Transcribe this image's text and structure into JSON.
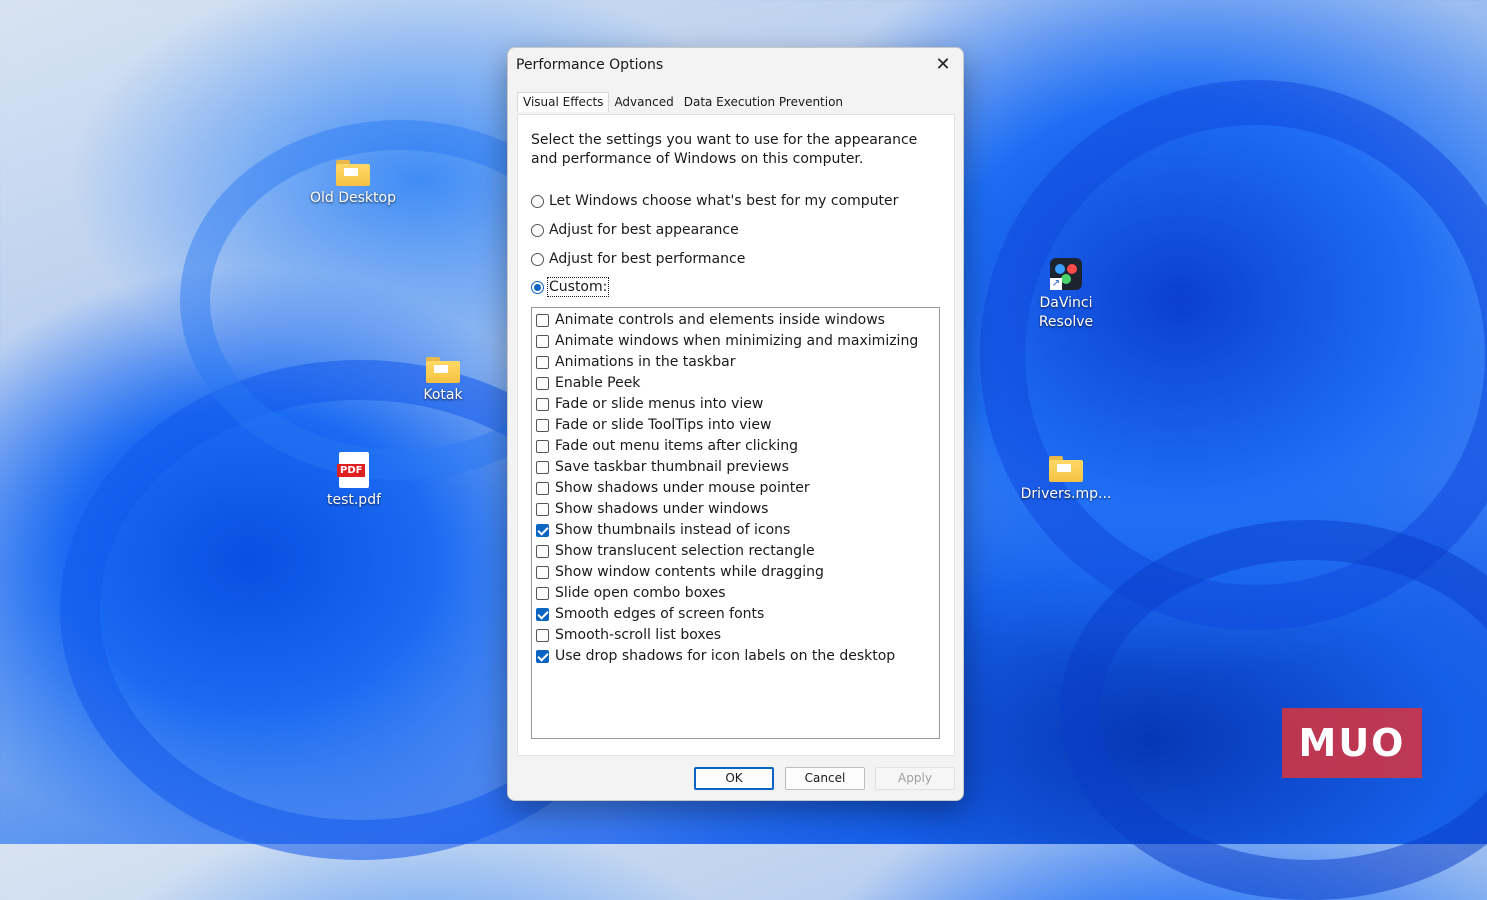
{
  "desktop": {
    "icons": [
      {
        "label": "Old Desktop"
      },
      {
        "label": "Kotak"
      },
      {
        "label": "test.pdf",
        "badge": "PDF"
      },
      {
        "label": "DaVinci Resolve"
      },
      {
        "label": "Drivers.mp..."
      }
    ],
    "watermark": "MUO"
  },
  "dialog": {
    "title": "Performance Options",
    "close_icon": "close-icon",
    "tabs": [
      {
        "label": "Visual Effects",
        "active": true
      },
      {
        "label": "Advanced",
        "active": false
      },
      {
        "label": "Data Execution Prevention",
        "active": false
      }
    ],
    "description": "Select the settings you want to use for the appearance and performance of Windows on this computer.",
    "radios": [
      {
        "label": "Let Windows choose what's best for my computer",
        "checked": false
      },
      {
        "label": "Adjust for best appearance",
        "checked": false
      },
      {
        "label": "Adjust for best performance",
        "checked": false
      },
      {
        "label": "Custom:",
        "checked": true
      }
    ],
    "options": [
      {
        "label": "Animate controls and elements inside windows",
        "checked": false
      },
      {
        "label": "Animate windows when minimizing and maximizing",
        "checked": false
      },
      {
        "label": "Animations in the taskbar",
        "checked": false
      },
      {
        "label": "Enable Peek",
        "checked": false
      },
      {
        "label": "Fade or slide menus into view",
        "checked": false
      },
      {
        "label": "Fade or slide ToolTips into view",
        "checked": false
      },
      {
        "label": "Fade out menu items after clicking",
        "checked": false
      },
      {
        "label": "Save taskbar thumbnail previews",
        "checked": false
      },
      {
        "label": "Show shadows under mouse pointer",
        "checked": false
      },
      {
        "label": "Show shadows under windows",
        "checked": false
      },
      {
        "label": "Show thumbnails instead of icons",
        "checked": true
      },
      {
        "label": "Show translucent selection rectangle",
        "checked": false
      },
      {
        "label": "Show window contents while dragging",
        "checked": false
      },
      {
        "label": "Slide open combo boxes",
        "checked": false
      },
      {
        "label": "Smooth edges of screen fonts",
        "checked": true
      },
      {
        "label": "Smooth-scroll list boxes",
        "checked": false
      },
      {
        "label": "Use drop shadows for icon labels on the desktop",
        "checked": true
      }
    ],
    "buttons": {
      "ok": "OK",
      "cancel": "Cancel",
      "apply": "Apply"
    },
    "accent_color": "#0a64c2"
  }
}
